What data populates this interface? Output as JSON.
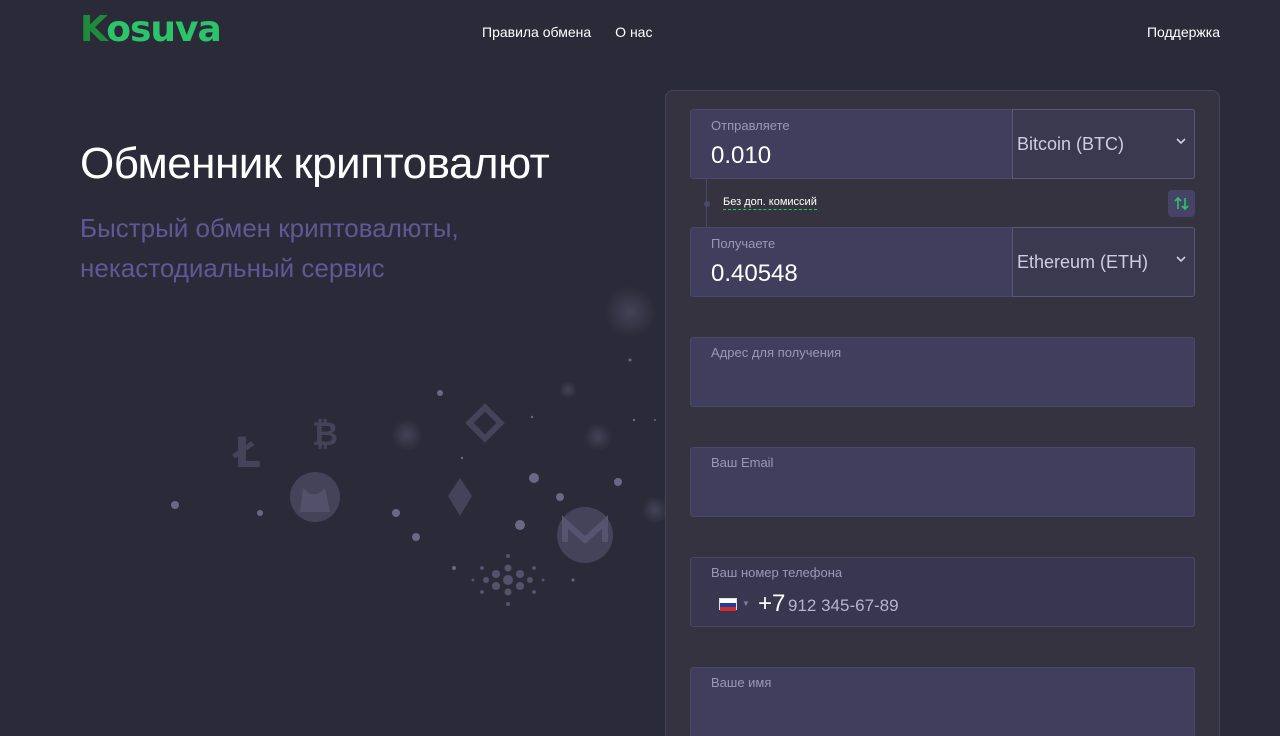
{
  "header": {
    "logo_first": "K",
    "logo_rest": "osuva",
    "nav": [
      "Правила обмена",
      "О нас"
    ],
    "support": "Поддержка"
  },
  "hero": {
    "title": "Обменник криптовалют",
    "subtitle": "Быстрый обмен криптовалюты, некастодиальный сервис"
  },
  "exchange": {
    "send": {
      "label": "Отправляете",
      "value": "0.010",
      "currency": "Bitcoin (BTC)"
    },
    "fee_note": "Без доп. комиссий",
    "receive": {
      "label": "Получаете",
      "value": "0.40548",
      "currency": "Ethereum (ETH)"
    },
    "address": {
      "label": "Адрес для получения"
    },
    "email": {
      "label": "Ваш Email"
    },
    "phone": {
      "label": "Ваш номер телефона",
      "code": "+7",
      "placeholder": "912 345-67-89"
    },
    "name": {
      "label": "Ваше имя"
    }
  },
  "colors": {
    "background": "#2a2a38",
    "panel": "#34333f",
    "field": "#403e5c",
    "accent": "#2cc46a",
    "subtitle": "#5f5894"
  },
  "icons": [
    "swap-arrows-icon",
    "chevron-down-icon",
    "russia-flag-icon",
    "litecoin-icon",
    "bitcoin-icon",
    "binance-icon",
    "dogecoin-icon",
    "ethereum-icon",
    "monero-icon",
    "cardano-icon"
  ]
}
